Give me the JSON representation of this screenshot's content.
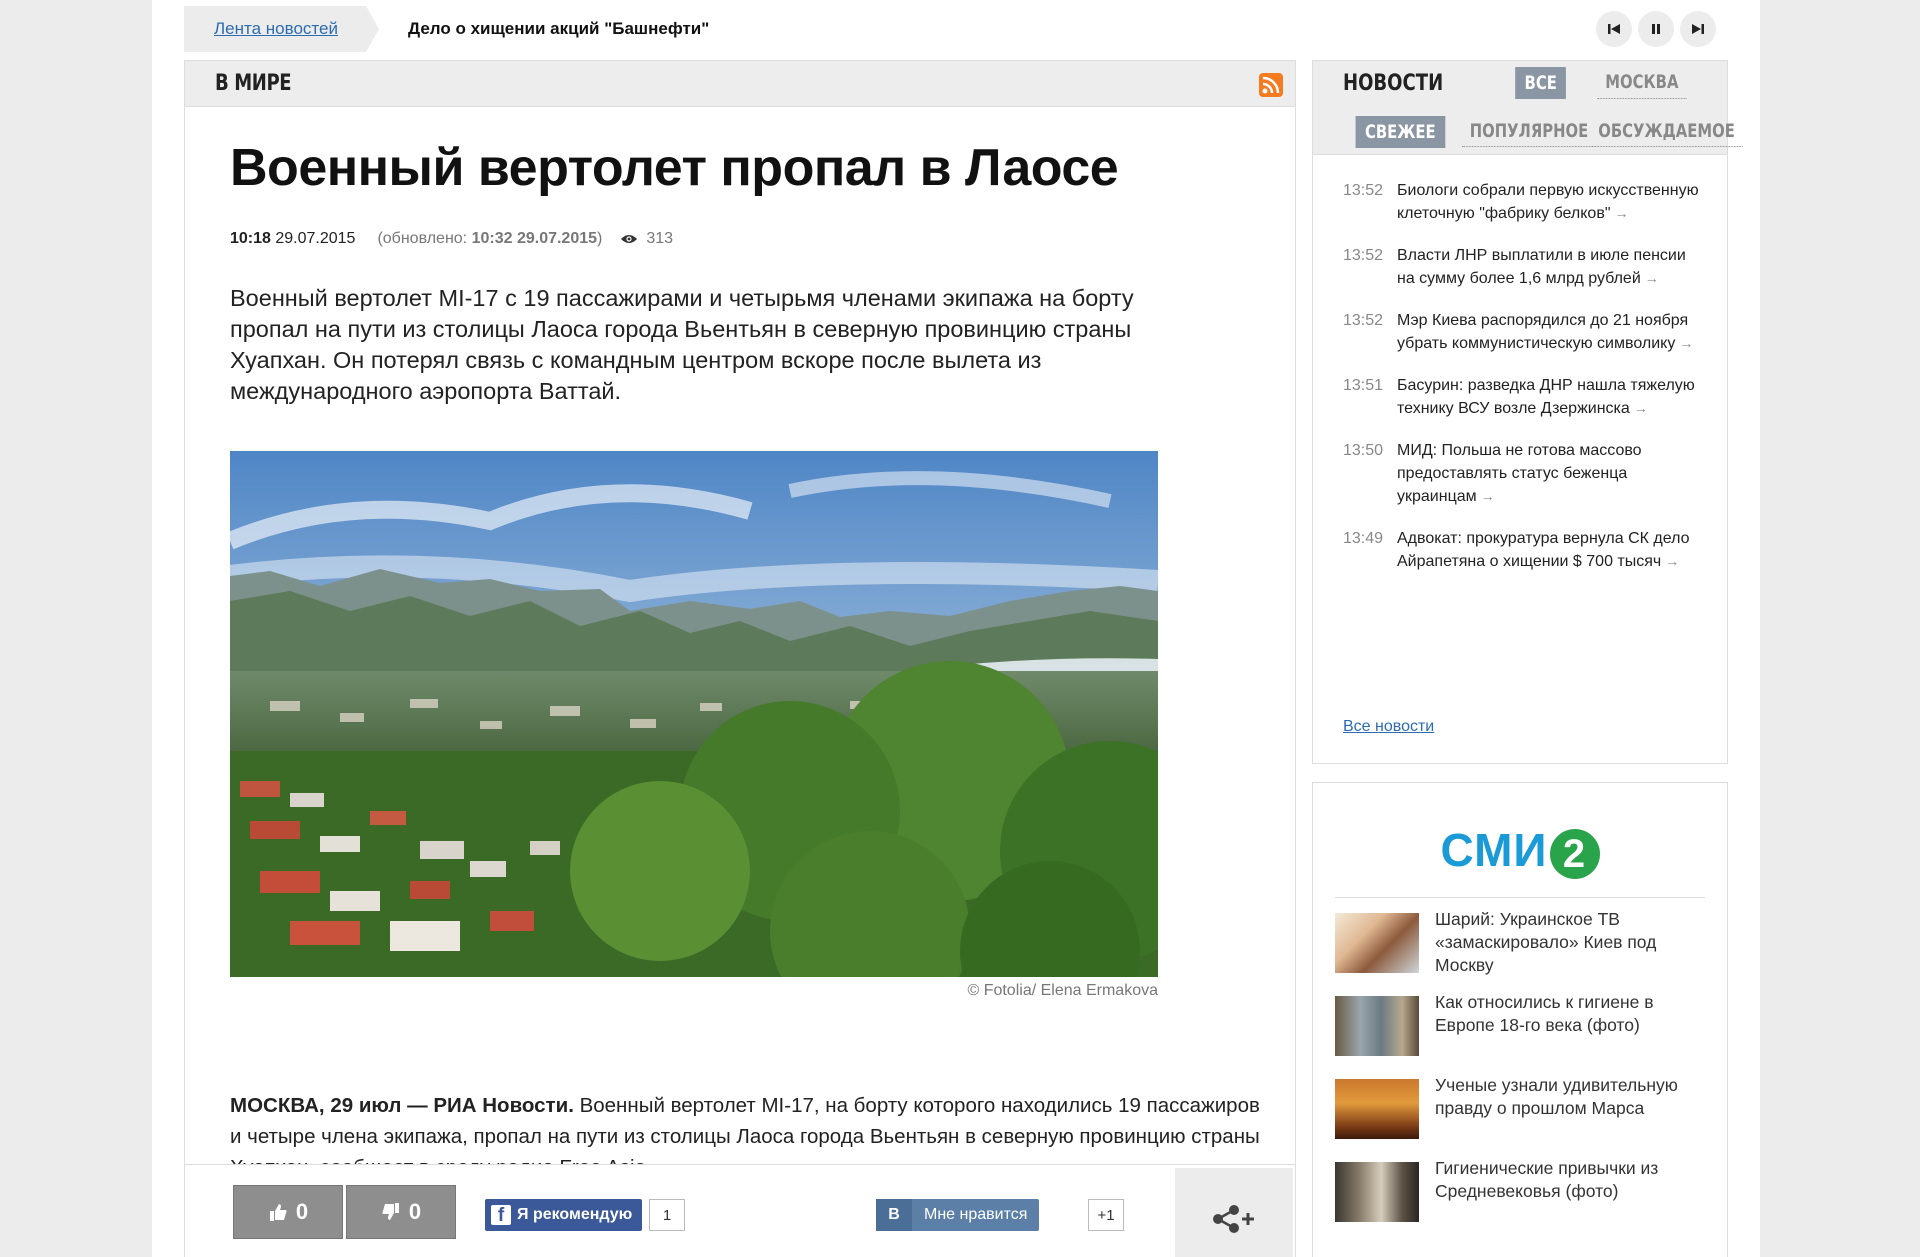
{
  "ticker": {
    "tab_label": "Лента новостей",
    "headline": "Дело о хищении акций \"Башнефти\"",
    "controls": [
      "previous-icon",
      "pause-icon",
      "next-icon"
    ]
  },
  "section": {
    "title": "В МИРЕ",
    "rss_icon": "rss-icon"
  },
  "article": {
    "headline": "Военный вертолет пропал в Лаосе",
    "time": "10:18",
    "date": "29.07.2015",
    "updated_prefix": "(обновлено: ",
    "updated_time": "10:32 29.07.2015",
    "updated_suffix": ")",
    "views": "313",
    "lead": "Военный вертолет MI-17 с 19 пассажирами и четырьмя членами экипажа на борту пропал на пути из столицы Лаоса города Вьентьян в северную провинцию страны Хуапхан. Он потерял связь с командным центром вскоре после вылета из международного аэропорта Ваттай.",
    "photo_credit": "© Fotolia/ Elena Ermakova",
    "body_dateline": "МОСКВА, 29 июл — РИА Новости.",
    "body_text": " Военный вертолет MI-17, на борту которого находились 19 пассажиров и четыре члена экипажа, пропал на пути из столицы Лаоса города Вьентьян в северную провинцию страны Хуапхан, сообщает в среду радио Free Asia."
  },
  "actions": {
    "like_count": "0",
    "dislike_count": "0",
    "fb_label": "Я рекомендую",
    "fb_count": "1",
    "vk_logo": "В",
    "vk_label": "Мне нравится",
    "vk_count": "+1",
    "share_icon": "share-icon"
  },
  "news": {
    "title": "НОВОСТИ",
    "region_tabs": [
      "ВСЕ",
      "МОСКВА"
    ],
    "sort_tabs": [
      "СВЕЖЕЕ",
      "ПОПУЛЯРНОЕ",
      "ОБСУЖДАЕМОЕ"
    ],
    "items": [
      {
        "time": "13:52",
        "text": "Биологи собрали первую искусственную клеточную \"фабрику белков\""
      },
      {
        "time": "13:52",
        "text": "Власти ЛНР выплатили в июле пенсии на сумму более 1,6 млрд рублей"
      },
      {
        "time": "13:52",
        "text": "Мэр Киева распорядился до 21 ноября убрать коммунистическую символику"
      },
      {
        "time": "13:51",
        "text": "Басурин: разведка ДНР нашла тяжелую технику ВСУ возле Дзержинска"
      },
      {
        "time": "13:50",
        "text": "МИД: Польша не готова массово предоставлять статус беженца украинцам"
      },
      {
        "time": "13:49",
        "text": "Адвокат: прокуратура вернула СК дело Айрапетяна о хищении $ 700 тысяч"
      }
    ],
    "arrow": "→",
    "all_news_label": "Все новости"
  },
  "smi2": {
    "logo_text": "СМИ",
    "logo_number": "2",
    "items": [
      {
        "text": "Шарий: Украинское ТВ «замаскировало» Киев под Москву"
      },
      {
        "text": "Как относились к гигиене в Европе 18-го века (фото)"
      },
      {
        "text": "Ученые узнали удивительную правду о прошлом Марса"
      },
      {
        "text": "Гигиенические привычки из Средневековья (фото)"
      }
    ]
  },
  "colors": {
    "link": "#2b6cb0",
    "fb": "#3b5998",
    "vk": "#5b7fa6",
    "rss": "#f47b20",
    "smi_blue": "#1a9ad6",
    "smi_green": "#2aa44a",
    "tab_active": "#8a96a3"
  }
}
